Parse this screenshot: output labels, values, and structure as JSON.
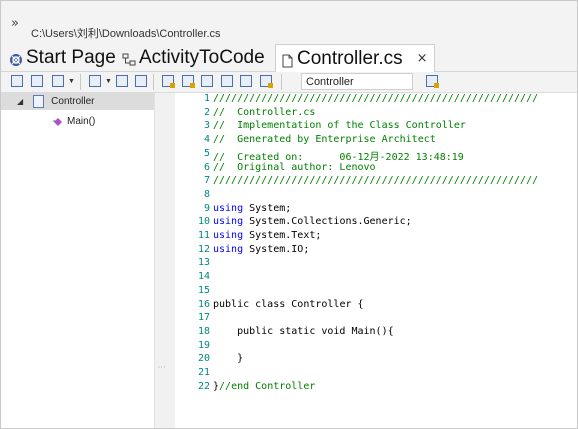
{
  "path_bar": {
    "chevron": "»",
    "path": "C:\\Users\\刘利\\Downloads\\Controller.cs"
  },
  "tabs": [
    {
      "label": "Start Page",
      "icon": "start-page-icon"
    },
    {
      "label": "ActivityToCode",
      "icon": "diagram-icon"
    },
    {
      "label": "Controller.cs",
      "icon": "file-icon",
      "active": true,
      "close": "×"
    }
  ],
  "toolbar": {
    "combo_value": "Controller"
  },
  "tree": {
    "root": {
      "label": "Controller",
      "expander": "◢"
    },
    "child": {
      "label": "Main()"
    }
  },
  "editor": {
    "lines": [
      {
        "num": "1",
        "parts": [
          {
            "t": "//////////////////////////////////////////////////////",
            "c": "com"
          }
        ]
      },
      {
        "num": "2",
        "parts": [
          {
            "t": "//  Controller.cs",
            "c": "com"
          }
        ]
      },
      {
        "num": "3",
        "parts": [
          {
            "t": "//  Implementation of the Class Controller",
            "c": "com"
          }
        ]
      },
      {
        "num": "4",
        "parts": [
          {
            "t": "//  Generated by Enterprise Architect",
            "c": "com"
          }
        ]
      },
      {
        "num": "5",
        "parts": [
          {
            "t": "//  Created on:      06-12月-2022 13:48:19",
            "c": "com"
          }
        ]
      },
      {
        "num": "6",
        "parts": [
          {
            "t": "//  Original author: Lenovo",
            "c": "com"
          }
        ]
      },
      {
        "num": "7",
        "parts": [
          {
            "t": "//////////////////////////////////////////////////////",
            "c": "com"
          }
        ]
      },
      {
        "num": "8",
        "parts": []
      },
      {
        "num": "9",
        "parts": [
          {
            "t": "using",
            "c": "kw"
          },
          {
            "t": " System;",
            "c": "txt"
          }
        ]
      },
      {
        "num": "10",
        "parts": [
          {
            "t": "using",
            "c": "kw"
          },
          {
            "t": " System.Collections.Generic;",
            "c": "txt"
          }
        ]
      },
      {
        "num": "11",
        "parts": [
          {
            "t": "using",
            "c": "kw"
          },
          {
            "t": " System.Text;",
            "c": "txt"
          }
        ]
      },
      {
        "num": "12",
        "parts": [
          {
            "t": "using",
            "c": "kw"
          },
          {
            "t": " System.IO;",
            "c": "txt"
          }
        ]
      },
      {
        "num": "13",
        "parts": []
      },
      {
        "num": "14",
        "parts": []
      },
      {
        "num": "15",
        "parts": []
      },
      {
        "num": "16",
        "parts": [
          {
            "t": "public class ",
            "c": "txt"
          },
          {
            "t": "Controller",
            "c": "hl"
          },
          {
            "t": " {",
            "c": "txt"
          }
        ]
      },
      {
        "num": "17",
        "parts": []
      },
      {
        "num": "18",
        "parts": [
          {
            "t": "    public static void Main(){",
            "c": "txt"
          }
        ]
      },
      {
        "num": "19",
        "parts": []
      },
      {
        "num": "20",
        "parts": [
          {
            "t": "    }",
            "c": "txt"
          }
        ]
      },
      {
        "num": "21",
        "parts": []
      },
      {
        "num": "22",
        "parts": [
          {
            "t": "}",
            "c": "txt"
          },
          {
            "t": "//end Controller",
            "c": "com"
          }
        ]
      }
    ]
  }
}
